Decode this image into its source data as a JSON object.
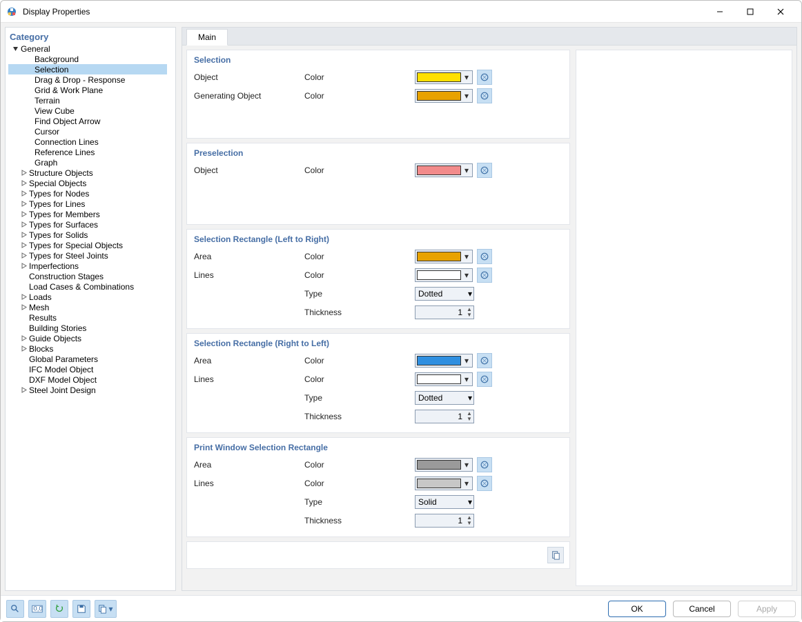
{
  "window_title": "Display Properties",
  "sidebar_title": "Category",
  "tree": {
    "general": "General",
    "general_children": [
      "Background",
      "Selection",
      "Drag & Drop - Response",
      "Grid & Work Plane",
      "Terrain",
      "View Cube",
      "Find Object Arrow",
      "Cursor",
      "Connection Lines",
      "Reference Lines",
      "Graph"
    ],
    "selected_child_index": 1,
    "collapsed": [
      "Structure Objects",
      "Special Objects",
      "Types for Nodes",
      "Types for Lines",
      "Types for Members",
      "Types for Surfaces",
      "Types for Solids",
      "Types for Special Objects",
      "Types for Steel Joints",
      "Imperfections"
    ],
    "flat_after": [
      "Construction Stages",
      "Load Cases & Combinations"
    ],
    "collapsed2": [
      "Loads",
      "Mesh"
    ],
    "flat_after2": [
      "Results",
      "Building Stories"
    ],
    "collapsed3": [
      "Guide Objects",
      "Blocks"
    ],
    "flat_after3": [
      "Global Parameters",
      "IFC Model Object",
      "DXF Model Object"
    ],
    "collapsed4": [
      "Steel Joint Design"
    ]
  },
  "tabs": {
    "main": "Main"
  },
  "labels": {
    "object": "Object",
    "generating_object": "Generating Object",
    "area": "Area",
    "lines": "Lines",
    "color": "Color",
    "type": "Type",
    "thickness": "Thickness"
  },
  "sections": {
    "selection": "Selection",
    "preselection": "Preselection",
    "sel_ltr": "Selection Rectangle (Left to Right)",
    "sel_rtl": "Selection Rectangle (Right to Left)",
    "print_win": "Print Window Selection Rectangle"
  },
  "values": {
    "selection_object_color": "#ffe000",
    "selection_genobj_color": "#e8a200",
    "preselection_object_color": "#f28b8b",
    "ltr_area_color": "#e8a200",
    "ltr_lines_color": "#ffffff",
    "ltr_type": "Dotted",
    "ltr_thickness": "1",
    "rtl_area_color": "#2f8fe0",
    "rtl_lines_color": "#ffffff",
    "rtl_type": "Dotted",
    "rtl_thickness": "1",
    "print_area_color": "#9a9a9a",
    "print_lines_color": "#c7c7c7",
    "print_type": "Solid",
    "print_thickness": "1"
  },
  "buttons": {
    "ok": "OK",
    "cancel": "Cancel",
    "apply": "Apply"
  }
}
